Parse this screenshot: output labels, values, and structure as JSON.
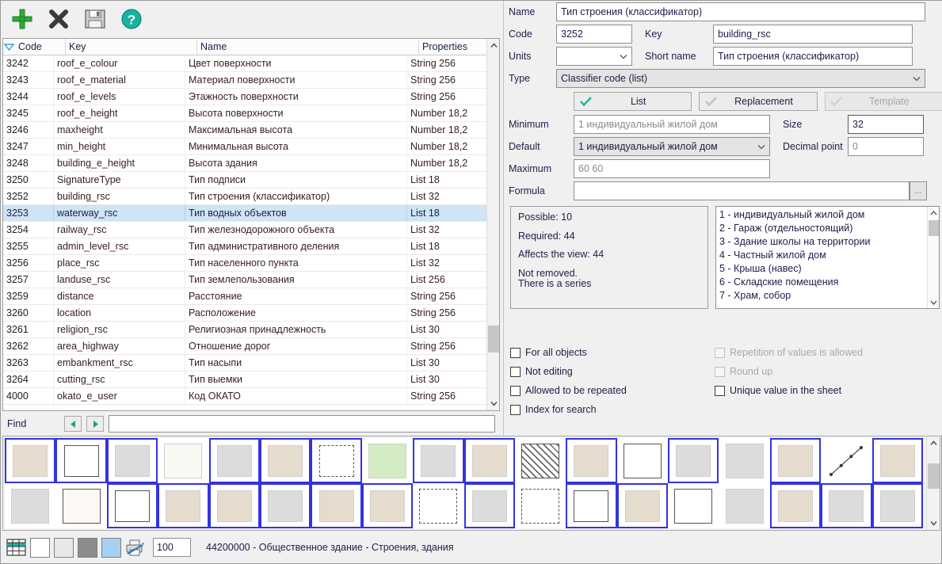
{
  "toolbar": {
    "add_label": "Add",
    "delete_label": "Delete",
    "save_label": "Save",
    "help_label": "Help"
  },
  "grid": {
    "columns": [
      "Code",
      "Key",
      "Name",
      "Properties"
    ],
    "selected_index": 9,
    "rows": [
      {
        "code": "3242",
        "key": "roof_e_colour",
        "name": "Цвет поверхности",
        "props": "String 256"
      },
      {
        "code": "3243",
        "key": "roof_e_material",
        "name": "Материал поверхности",
        "props": "String 256"
      },
      {
        "code": "3244",
        "key": "roof_e_levels",
        "name": "Этажность поверхности",
        "props": "String 256"
      },
      {
        "code": "3245",
        "key": "roof_e_height",
        "name": "Высота поверхности",
        "props": "Number 18,2"
      },
      {
        "code": "3246",
        "key": "maxheight",
        "name": "Максимальная высота",
        "props": "Number 18,2"
      },
      {
        "code": "3247",
        "key": "min_height",
        "name": "Минимальная высота",
        "props": "Number 18,2"
      },
      {
        "code": "3248",
        "key": "building_e_height",
        "name": "Высота здания",
        "props": "Number 18,2"
      },
      {
        "code": "3250",
        "key": "SignatureType",
        "name": "Тип подписи",
        "props": "List 18"
      },
      {
        "code": "3252",
        "key": "building_rsc",
        "name": "Тип строения (классификатор)",
        "props": "List 32"
      },
      {
        "code": "3253",
        "key": "waterway_rsc",
        "name": "Тип водных объектов",
        "props": "List 18"
      },
      {
        "code": "3254",
        "key": "railway_rsc",
        "name": "Тип железнодорожного объекта",
        "props": "List 32"
      },
      {
        "code": "3255",
        "key": "admin_level_rsc",
        "name": "Тип административного деления",
        "props": "List 18"
      },
      {
        "code": "3256",
        "key": "place_rsc",
        "name": "Тип населенного пункта",
        "props": "List 32"
      },
      {
        "code": "3257",
        "key": "landuse_rsc",
        "name": "Тип землепользования",
        "props": "List 256"
      },
      {
        "code": "3259",
        "key": "distance",
        "name": "Расстояние",
        "props": "String 256"
      },
      {
        "code": "3260",
        "key": "location",
        "name": "Расположение",
        "props": "String 256"
      },
      {
        "code": "3261",
        "key": "religion_rsc",
        "name": "Религиозная принадлежность",
        "props": "List 30"
      },
      {
        "code": "3262",
        "key": "area_highway",
        "name": "Отношение дорог",
        "props": "String 256"
      },
      {
        "code": "3263",
        "key": "embankment_rsc",
        "name": "Тип насыпи",
        "props": "List 30"
      },
      {
        "code": "3264",
        "key": "cutting_rsc",
        "name": "Тип выемки",
        "props": "List 30"
      },
      {
        "code": "4000",
        "key": "okato_e_user",
        "name": "Код ОКАТО",
        "props": "String 256"
      }
    ]
  },
  "find": {
    "label": "Find",
    "value": "",
    "placeholder": ""
  },
  "form": {
    "name_label": "Name",
    "name_value": "Тип строения (классификатор)",
    "code_label": "Code",
    "code_value": "3252",
    "key_label": "Key",
    "key_value": "building_rsc",
    "units_label": "Units",
    "units_value": "",
    "shortname_label": "Short name",
    "shortname_value": "Тип строения (классификатор)",
    "type_label": "Type",
    "type_value": "Classifier code (list)",
    "tab_list": "List",
    "tab_replacement": "Replacement",
    "tab_template": "Template",
    "minimum_label": "Minimum",
    "minimum_value": "1 индивидуальный жилой дом",
    "size_label": "Size",
    "size_value": "32",
    "default_label": "Default",
    "default_value": "1 индивидуальный жилой дом",
    "decimal_label": "Decimal point",
    "decimal_value": "0",
    "maximum_label": "Maximum",
    "maximum_value": "60 60",
    "formula_label": "Formula",
    "formula_value": "",
    "browse_label": "..."
  },
  "info": {
    "possible": "Possible: 10",
    "required": "Required: 44",
    "affects": "Affects the view: 44",
    "not_removed": "Not removed.",
    "series": "There is a series"
  },
  "classifier_list": [
    "1 - индивидуальный жилой дом",
    "2 - Гараж (отдельностоящий)",
    "3 - Здание школы на территории",
    "4 - Частный жилой дом",
    "5 - Крыша (навес)",
    "6 - Складские помещения",
    "7 - Храм, собор"
  ],
  "checkboxes": {
    "for_all_objects": {
      "label": "For all objects",
      "checked": false,
      "enabled": true
    },
    "not_editing": {
      "label": "Not editing",
      "checked": false,
      "enabled": true
    },
    "allowed_repeated": {
      "label": "Allowed to be repeated",
      "checked": false,
      "enabled": true
    },
    "index_for_search": {
      "label": "Index for search",
      "checked": false,
      "enabled": true
    },
    "repetition_allowed": {
      "label": "Repetition of values is allowed",
      "checked": false,
      "enabled": false
    },
    "round_up": {
      "label": "Round up",
      "checked": false,
      "enabled": false
    },
    "unique_value": {
      "label": "Unique value in the sheet",
      "checked": false,
      "enabled": true
    }
  },
  "swatches": {
    "row1": [
      {
        "fill": "#e6dccd",
        "selected": true,
        "style": "solid"
      },
      {
        "fill": "#ffffff",
        "selected": true,
        "style": "outline-dark"
      },
      {
        "fill": "#dcdcdc",
        "selected": true,
        "style": "solid"
      },
      {
        "fill": "#faf8f3",
        "selected": false,
        "style": "solid"
      },
      {
        "fill": "#dcdcdc",
        "selected": true,
        "style": "solid"
      },
      {
        "fill": "#e6dccd",
        "selected": true,
        "style": "solid"
      },
      {
        "fill": "#ffffff",
        "selected": true,
        "style": "dashed"
      },
      {
        "fill": "#d4ecc4",
        "selected": false,
        "style": "solid"
      },
      {
        "fill": "#dcdcdc",
        "selected": true,
        "style": "solid"
      },
      {
        "fill": "#e6dccd",
        "selected": true,
        "style": "solid"
      },
      {
        "fill": "#ffffff",
        "selected": false,
        "style": "hatch"
      },
      {
        "fill": "#e6dccd",
        "selected": true,
        "style": "solid"
      },
      {
        "fill": "#ffffff",
        "selected": false,
        "style": "outline-dark"
      },
      {
        "fill": "#dcdcdc",
        "selected": true,
        "style": "solid"
      },
      {
        "fill": "#dcdcdc",
        "selected": false,
        "style": "solid"
      },
      {
        "fill": "#e6dccd",
        "selected": true,
        "style": "solid"
      },
      {
        "fill": "#ffffff",
        "selected": false,
        "style": "diagonal-line"
      },
      {
        "fill": "#e6dccd",
        "selected": true,
        "style": "solid"
      }
    ],
    "row2": [
      {
        "fill": "#dcdcdc",
        "selected": false,
        "style": "solid"
      },
      {
        "fill": "#fdf8f3",
        "selected": false,
        "style": "outline-dark"
      },
      {
        "fill": "#ffffff",
        "selected": true,
        "style": "outline-dark"
      },
      {
        "fill": "#e6dccd",
        "selected": true,
        "style": "solid"
      },
      {
        "fill": "#e6dccd",
        "selected": true,
        "style": "solid"
      },
      {
        "fill": "#dcdcdc",
        "selected": true,
        "style": "solid"
      },
      {
        "fill": "#e6dccd",
        "selected": true,
        "style": "solid"
      },
      {
        "fill": "#e6dccd",
        "selected": true,
        "style": "solid"
      },
      {
        "fill": "#ffffff",
        "selected": false,
        "style": "dashed"
      },
      {
        "fill": "#dcdcdc",
        "selected": true,
        "style": "solid"
      },
      {
        "fill": "#ffffff",
        "selected": false,
        "style": "dashed"
      },
      {
        "fill": "#ffffff",
        "selected": true,
        "style": "outline-dark"
      },
      {
        "fill": "#e6dccd",
        "selected": true,
        "style": "solid"
      },
      {
        "fill": "#ffffff",
        "selected": false,
        "style": "outline-dark"
      },
      {
        "fill": "#dcdcdc",
        "selected": false,
        "style": "solid"
      },
      {
        "fill": "#e6dccd",
        "selected": true,
        "style": "solid"
      },
      {
        "fill": "#dcdcdc",
        "selected": true,
        "style": "solid"
      },
      {
        "fill": "#dcdcdc",
        "selected": true,
        "style": "solid"
      }
    ]
  },
  "status": {
    "color_white": "#ffffff",
    "color_light": "#e8e8e8",
    "color_gray": "#8c8c8c",
    "color_blue": "#a8d0f0",
    "zoom_value": "100",
    "text": "44200000 - Общественное здание - Строения, здания"
  }
}
